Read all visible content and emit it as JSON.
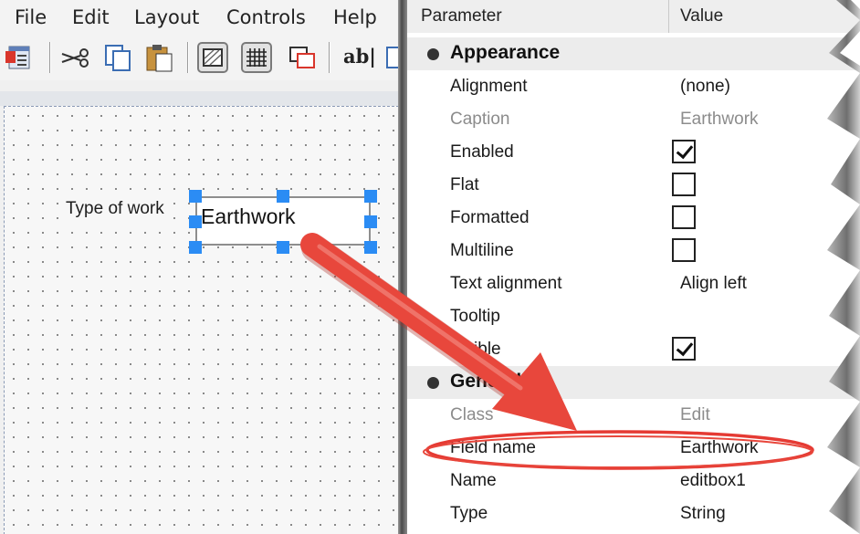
{
  "menu": {
    "items": [
      "File",
      "Edit",
      "Layout",
      "Controls",
      "Help"
    ]
  },
  "toolbar": {
    "icons": [
      "form-icon",
      "cut-icon",
      "copy-icon",
      "paste-icon",
      "grid-fill-icon",
      "grid-dots-icon",
      "layer-icon",
      "text-tool-icon"
    ],
    "text_tool_label": "ab|"
  },
  "form": {
    "label_text": "Type of work",
    "editbox_value": "Earthwork"
  },
  "property_grid": {
    "header": {
      "parameter": "Parameter",
      "value": "Value"
    },
    "appearance": {
      "title": "Appearance",
      "alignment": {
        "name": "Alignment",
        "value": "(none)"
      },
      "caption": {
        "name": "Caption",
        "value": "Earthwork"
      },
      "enabled": {
        "name": "Enabled",
        "checked": true
      },
      "flat": {
        "name": "Flat",
        "checked": false
      },
      "formatted": {
        "name": "Formatted",
        "checked": false
      },
      "multiline": {
        "name": "Multiline",
        "checked": false
      },
      "text_alignment": {
        "name": "Text alignment",
        "value": "Align left"
      },
      "tooltip": {
        "name": "Tooltip",
        "value": ""
      },
      "visible": {
        "name": "Visible",
        "checked": true
      }
    },
    "general": {
      "title": "General",
      "class": {
        "name": "Class",
        "value": "Edit"
      },
      "field_name": {
        "name": "Field name",
        "value": "Earthwork"
      },
      "name": {
        "name": "Name",
        "value": "editbox1"
      },
      "type": {
        "name": "Type",
        "value": "String"
      }
    }
  },
  "colors": {
    "annotation": "#e8473c",
    "selection_handle": "#2b8cf4"
  }
}
